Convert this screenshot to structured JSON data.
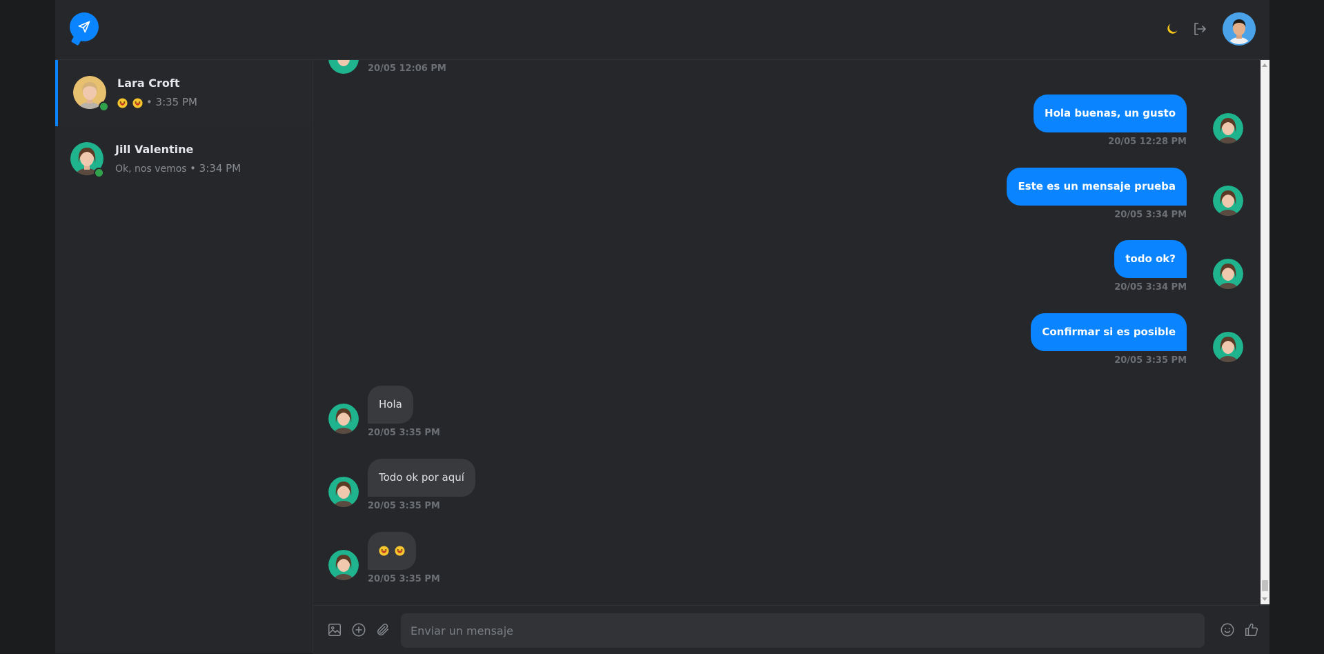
{
  "header": {
    "logo_icon": "paper-plane-icon",
    "theme_icon": "moon-icon",
    "logout_icon": "logout-icon",
    "accent_color": "#0a84ff"
  },
  "sidebar": {
    "chats": [
      {
        "name": "Lara Croft",
        "preview_icons": [
          "laughing-emoji",
          "laughing-emoji"
        ],
        "time": "• 3:35 PM",
        "online": true,
        "active": true
      },
      {
        "name": "Jill Valentine",
        "preview": "Ok, nos vemos",
        "time": "• 3:34 PM",
        "online": true,
        "active": false
      }
    ]
  },
  "messages": [
    {
      "direction": "in",
      "text": "",
      "time": "20/05 12:06 PM"
    },
    {
      "direction": "out",
      "text": "Hola buenas, un gusto",
      "time": "20/05 12:28 PM"
    },
    {
      "direction": "out",
      "text": "Este es un mensaje prueba",
      "time": "20/05 3:34 PM"
    },
    {
      "direction": "out",
      "text": "todo ok?",
      "time": "20/05 3:34 PM"
    },
    {
      "direction": "out",
      "text": "Confirmar si es posible",
      "time": "20/05 3:35 PM"
    },
    {
      "direction": "in",
      "text": "Hola",
      "time": "20/05 3:35 PM"
    },
    {
      "direction": "in",
      "text": "Todo ok por aquí",
      "time": "20/05 3:35 PM"
    },
    {
      "direction": "in",
      "icons": [
        "laughing-emoji",
        "laughing-emoji"
      ],
      "time": "20/05 3:35 PM"
    }
  ],
  "composer": {
    "placeholder": "Enviar un mensaje",
    "image_icon": "image-icon",
    "add_icon": "plus-circle-icon",
    "attach_icon": "paperclip-icon",
    "emoji_icon": "smile-icon",
    "like_icon": "thumbs-up-icon"
  }
}
